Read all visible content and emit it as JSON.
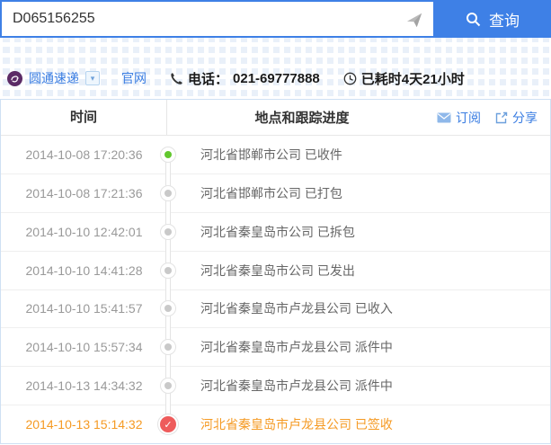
{
  "search": {
    "tracking_number": "D065156255",
    "button_label": "查询"
  },
  "carrier": {
    "name": "圆通速递",
    "official_site": "官网",
    "phone_label": "电话：",
    "phone_number": "021-69777888",
    "elapsed": "已耗时4天21小时"
  },
  "table": {
    "headers": {
      "time": "时间",
      "progress": "地点和跟踪进度"
    },
    "actions": {
      "subscribe": "订阅",
      "share": "分享"
    },
    "rows": [
      {
        "time": "2014-10-08 17:20:36",
        "text": "河北省邯郸市公司 已收件",
        "status": "received"
      },
      {
        "time": "2014-10-08 17:21:36",
        "text": "河北省邯郸市公司 已打包",
        "status": "transit"
      },
      {
        "time": "2014-10-10 12:42:01",
        "text": "河北省秦皇岛市公司 已拆包",
        "status": "transit"
      },
      {
        "time": "2014-10-10 14:41:28",
        "text": "河北省秦皇岛市公司 已发出",
        "status": "transit"
      },
      {
        "time": "2014-10-10 15:41:57",
        "text": "河北省秦皇岛市卢龙县公司 已收入",
        "status": "transit"
      },
      {
        "time": "2014-10-10 15:57:34",
        "text": "河北省秦皇岛市卢龙县公司 派件中",
        "status": "transit"
      },
      {
        "time": "2014-10-13 14:34:32",
        "text": "河北省秦皇岛市卢龙县公司 派件中",
        "status": "transit"
      },
      {
        "time": "2014-10-13 15:14:32",
        "text": "河北省秦皇岛市卢龙县公司 已签收",
        "status": "signed"
      }
    ]
  },
  "icons": {
    "check": "✓",
    "caret_down": "▾"
  },
  "colors": {
    "accent_blue": "#3E80E6",
    "link_blue": "#3A7DE2",
    "signed_orange": "#F59A23",
    "received_green": "#62C72E",
    "signed_red": "#EE5B5B",
    "logo_purple": "#5C2B66"
  }
}
